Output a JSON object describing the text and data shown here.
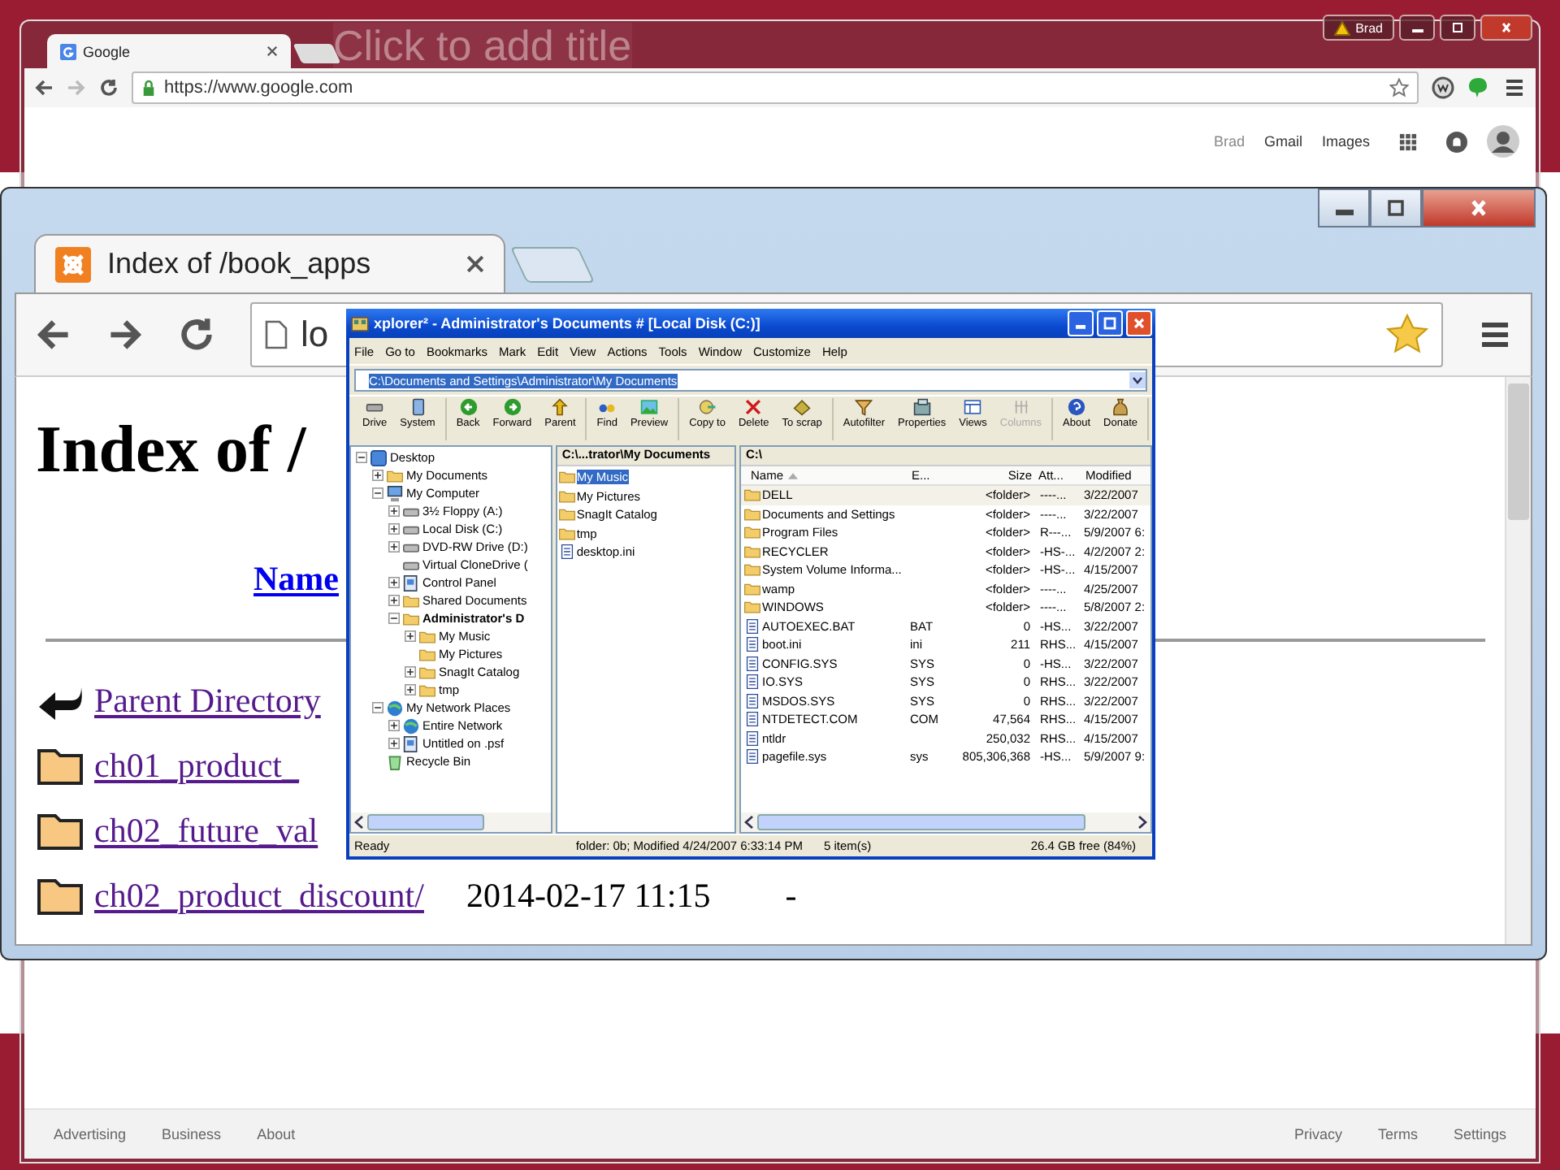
{
  "slide": {
    "title_placeholder": "Click to add title"
  },
  "google_window": {
    "profile": "Brad",
    "tab": {
      "title": "Google",
      "selected": true
    },
    "url": "https://www.google.com",
    "forward_disabled": true,
    "top_links": [
      {
        "label": "Brad",
        "muted": true
      },
      {
        "label": "Gmail",
        "muted": false
      },
      {
        "label": "Images",
        "muted": false
      }
    ],
    "footer_left": [
      "Advertising",
      "Business",
      "About"
    ],
    "footer_right": [
      "Privacy",
      "Terms",
      "Settings"
    ]
  },
  "index_window": {
    "tab": {
      "title": "Index of /book_apps",
      "selected": true
    },
    "url": "lo",
    "heading": "Index of /",
    "column_heading": "Name",
    "entries": [
      {
        "kind": "parent",
        "name": "Parent Directory"
      },
      {
        "kind": "folder",
        "name": "ch01_product_"
      },
      {
        "kind": "folder",
        "name": "ch02_future_val"
      },
      {
        "kind": "folder",
        "name": "ch02_product_discount/",
        "modified": "2014-02-17 11:15",
        "size": "-"
      }
    ]
  },
  "xplorer": {
    "title": "xplorer² - Administrator's Documents # [Local Disk (C:)]",
    "menu": [
      "File",
      "Go to",
      "Bookmarks",
      "Mark",
      "Edit",
      "View",
      "Actions",
      "Tools",
      "Window",
      "Customize",
      "Help"
    ],
    "path": "C:\\Documents and Settings\\Administrator\\My Documents",
    "toolbar": [
      [
        {
          "label": "Drive",
          "disabled": false
        },
        {
          "label": "System",
          "disabled": false
        }
      ],
      [
        {
          "label": "Back",
          "disabled": false
        },
        {
          "label": "Forward",
          "disabled": false
        },
        {
          "label": "Parent",
          "disabled": false
        }
      ],
      [
        {
          "label": "Find",
          "disabled": false
        },
        {
          "label": "Preview",
          "disabled": false
        }
      ],
      [
        {
          "label": "Copy to",
          "disabled": false
        },
        {
          "label": "Delete",
          "disabled": false
        },
        {
          "label": "To scrap",
          "disabled": false
        }
      ],
      [
        {
          "label": "Autofilter",
          "disabled": false
        },
        {
          "label": "Properties",
          "disabled": false
        },
        {
          "label": "Views",
          "disabled": false
        },
        {
          "label": "Columns",
          "disabled": true
        }
      ],
      [
        {
          "label": "About",
          "disabled": false
        },
        {
          "label": "Donate",
          "disabled": false
        }
      ]
    ],
    "tree": [
      {
        "label": "Desktop",
        "kind": "desktop",
        "expanded": true,
        "selected": false,
        "children": [
          {
            "label": "My Documents",
            "kind": "folder",
            "expanded": false,
            "selected": false
          },
          {
            "label": "My Computer",
            "kind": "computer",
            "expanded": true,
            "selected": false,
            "children": [
              {
                "label": "3½ Floppy (A:)",
                "kind": "drive",
                "expanded": false,
                "selected": false
              },
              {
                "label": "Local Disk (C:)",
                "kind": "drive",
                "expanded": false,
                "selected": false
              },
              {
                "label": "DVD-RW Drive (D:)",
                "kind": "drive",
                "expanded": false,
                "selected": false
              },
              {
                "label": "Virtual CloneDrive (",
                "kind": "drive",
                "selected": false
              },
              {
                "label": "Control Panel",
                "kind": "panel",
                "expanded": false,
                "selected": false
              },
              {
                "label": "Shared Documents",
                "kind": "folder",
                "expanded": false,
                "selected": false
              },
              {
                "label": "Administrator's D",
                "kind": "folder",
                "expanded": true,
                "selected": true,
                "children": [
                  {
                    "label": "My Music",
                    "kind": "folder",
                    "expanded": false,
                    "selected": false
                  },
                  {
                    "label": "My Pictures",
                    "kind": "folder",
                    "selected": false
                  },
                  {
                    "label": "SnagIt Catalog",
                    "kind": "folder",
                    "expanded": false,
                    "selected": false
                  },
                  {
                    "label": "tmp",
                    "kind": "folder",
                    "expanded": false,
                    "selected": false
                  }
                ]
              }
            ]
          },
          {
            "label": "My Network Places",
            "kind": "globe",
            "expanded": true,
            "selected": false,
            "children": [
              {
                "label": "Entire Network",
                "kind": "globe",
                "expanded": false,
                "selected": false
              },
              {
                "label": "Untitled on .psf",
                "kind": "panel",
                "expanded": false,
                "selected": false
              }
            ]
          },
          {
            "label": "Recycle Bin",
            "kind": "bin",
            "selected": false
          }
        ]
      }
    ],
    "middle_pane": {
      "header": "C:\\...trator\\My Documents",
      "items": [
        {
          "name": "My Music",
          "kind": "folder",
          "selected": true
        },
        {
          "name": "My Pictures",
          "kind": "folder",
          "selected": false
        },
        {
          "name": "SnagIt Catalog",
          "kind": "folder",
          "selected": false
        },
        {
          "name": "tmp",
          "kind": "folder",
          "selected": false
        },
        {
          "name": "desktop.ini",
          "kind": "file",
          "selected": false
        }
      ]
    },
    "right_pane": {
      "header": "C:\\",
      "columns": [
        "Name",
        "E...",
        "Size",
        "Att...",
        "Modified"
      ],
      "rows": [
        {
          "kind": "folder",
          "name": "DELL",
          "ext": "",
          "size": "<folder>",
          "attr": "----...",
          "modified": "3/22/2007",
          "selected": true
        },
        {
          "kind": "folder",
          "name": "Documents and Settings",
          "size": "<folder>",
          "attr": "----...",
          "modified": "3/22/2007",
          "selected": false
        },
        {
          "kind": "folder",
          "name": "Program Files",
          "size": "<folder>",
          "attr": "R---...",
          "modified": "5/9/2007 6:",
          "selected": false
        },
        {
          "kind": "folder",
          "name": "RECYCLER",
          "size": "<folder>",
          "attr": "-HS-...",
          "modified": "4/2/2007 2:",
          "selected": false
        },
        {
          "kind": "folder",
          "name": "System Volume Informa...",
          "size": "<folder>",
          "attr": "-HS-...",
          "modified": "4/15/2007",
          "selected": false
        },
        {
          "kind": "folder",
          "name": "wamp",
          "size": "<folder>",
          "attr": "----...",
          "modified": "4/25/2007",
          "selected": false
        },
        {
          "kind": "folder",
          "name": "WINDOWS",
          "size": "<folder>",
          "attr": "----...",
          "modified": "5/8/2007 2:",
          "selected": false
        },
        {
          "kind": "file",
          "name": "AUTOEXEC.BAT",
          "ext": "BAT",
          "size": "0",
          "attr": "-HS...",
          "modified": "3/22/2007",
          "selected": false
        },
        {
          "kind": "file",
          "name": "boot.ini",
          "ext": "ini",
          "size": "211",
          "attr": "RHS...",
          "modified": "4/15/2007",
          "selected": false
        },
        {
          "kind": "file",
          "name": "CONFIG.SYS",
          "ext": "SYS",
          "size": "0",
          "attr": "-HS...",
          "modified": "3/22/2007",
          "selected": false
        },
        {
          "kind": "file",
          "name": "IO.SYS",
          "ext": "SYS",
          "size": "0",
          "attr": "RHS...",
          "modified": "3/22/2007",
          "selected": false
        },
        {
          "kind": "file",
          "name": "MSDOS.SYS",
          "ext": "SYS",
          "size": "0",
          "attr": "RHS...",
          "modified": "3/22/2007",
          "selected": false
        },
        {
          "kind": "file",
          "name": "NTDETECT.COM",
          "ext": "COM",
          "size": "47,564",
          "attr": "RHS...",
          "modified": "4/15/2007",
          "selected": false
        },
        {
          "kind": "file",
          "name": "ntldr",
          "size": "250,032",
          "attr": "RHS...",
          "modified": "4/15/2007",
          "selected": false
        },
        {
          "kind": "file",
          "name": "pagefile.sys",
          "ext": "sys",
          "size": "805,306,368",
          "attr": "-HS...",
          "modified": "5/9/2007 9:",
          "selected": false
        }
      ]
    },
    "status": [
      "Ready",
      "folder: 0b; Modified 4/24/2007 6:33:14 PM",
      "5 item(s)",
      "26.4 GB free (84%)"
    ]
  }
}
